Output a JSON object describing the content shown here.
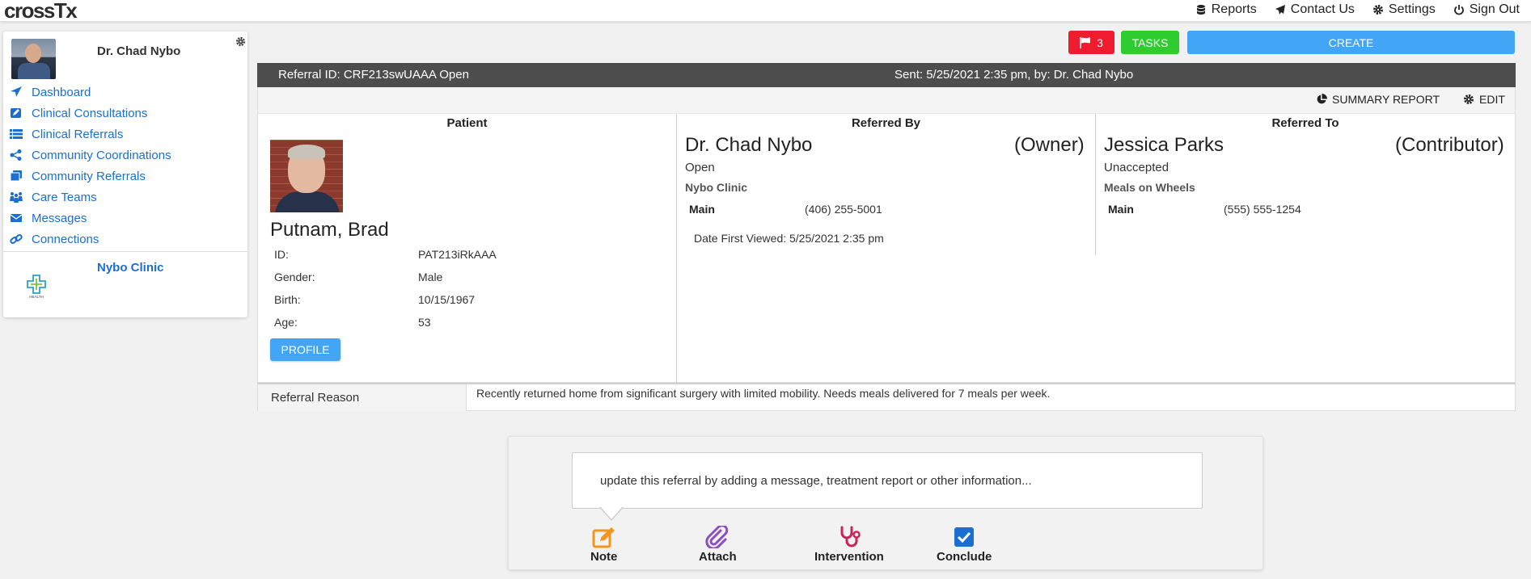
{
  "app": {
    "logo_text": "crossTx"
  },
  "topnav": {
    "reports": "Reports",
    "contact": "Contact Us",
    "settings": "Settings",
    "signout": "Sign Out"
  },
  "sidebar": {
    "user_name": "Dr. Chad Nybo",
    "items": [
      {
        "label": "Dashboard",
        "icon": "paper-plane-icon"
      },
      {
        "label": "Clinical Consultations",
        "icon": "edit-square-icon"
      },
      {
        "label": "Clinical Referrals",
        "icon": "list-icon"
      },
      {
        "label": "Community Coordinations",
        "icon": "share-icon"
      },
      {
        "label": "Community Referrals",
        "icon": "stack-icon"
      },
      {
        "label": "Care Teams",
        "icon": "people-icon"
      },
      {
        "label": "Messages",
        "icon": "envelope-icon"
      },
      {
        "label": "Connections",
        "icon": "link-icon"
      }
    ],
    "org_name": "Nybo Clinic",
    "org_logo_text": "HEALTH"
  },
  "actions": {
    "flag_count": "3",
    "tasks": "TASKS",
    "create": "CREATE"
  },
  "referral": {
    "id_text": "Referral ID: CRF213swUAAA Open",
    "sent_text": "Sent: 5/25/2021 2:35 pm, by: Dr. Chad Nybo",
    "summary_report": "SUMMARY REPORT",
    "edit": "EDIT",
    "patient_title": "Patient",
    "referred_by_title": "Referred By",
    "referred_to_title": "Referred To",
    "patient": {
      "name": "Putnam, Brad",
      "fields": [
        {
          "label": "ID:",
          "value": "PAT213iRkAAA"
        },
        {
          "label": "Gender:",
          "value": "Male"
        },
        {
          "label": "Birth:",
          "value": "10/15/1967"
        },
        {
          "label": "Age:",
          "value": "53"
        }
      ],
      "profile_button": "PROFILE"
    },
    "referred_by": {
      "name": "Dr. Chad Nybo",
      "role": "(Owner)",
      "status": "Open",
      "org": "Nybo Clinic",
      "phone_label": "Main",
      "phone": "(406) 255-5001",
      "date_viewed": "Date First Viewed: 5/25/2021 2:35 pm"
    },
    "referred_to": {
      "name": "Jessica Parks",
      "role": "(Contributor)",
      "status": "Unaccepted",
      "org": "Meals on Wheels",
      "phone_label": "Main",
      "phone": "(555) 555-1254"
    },
    "reason_label": "Referral Reason",
    "reason_text": "Recently returned home from significant surgery with limited mobility.  Needs meals delivered for 7 meals per week."
  },
  "update": {
    "placeholder": "update this referral by adding a message, treatment report or other information...",
    "actions": {
      "note": "Note",
      "attach": "Attach",
      "intervention": "Intervention",
      "conclude": "Conclude"
    }
  },
  "colors": {
    "link_blue": "#1a6fd1",
    "create_blue": "#43a5f5",
    "flag_red": "#ee1c2e",
    "tasks_green": "#2fcc2f",
    "header_gray": "#4d4d4d",
    "note_orange": "#f5961c",
    "attach_purple": "#8a4fc4",
    "intervention_red": "#c8245a",
    "conclude_blue": "#1a6fd1"
  }
}
